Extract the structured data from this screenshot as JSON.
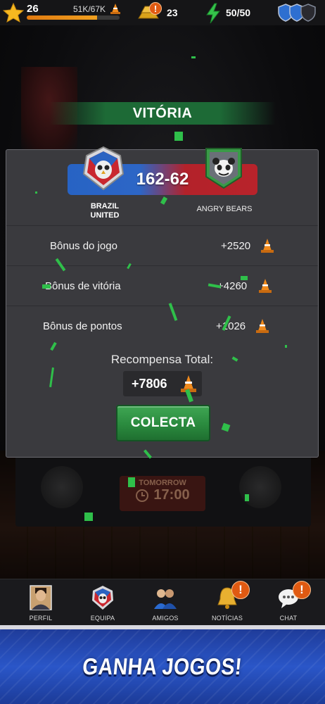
{
  "top_bar": {
    "level": "26",
    "xp_text": "51K/67K",
    "xp_progress": 0.76,
    "gold_count": "23",
    "energy_count": "50/50"
  },
  "result": {
    "banner": "VITÓRIA",
    "home_team": "BRAZIL UNITED",
    "away_team": "ANGRY BEARS",
    "score_home": "162",
    "score_sep": "-",
    "score_away": "62",
    "bonuses": [
      {
        "label": "Bônus do jogo",
        "value": "+2520"
      },
      {
        "label": "Bônus de vitória",
        "value": "+4260"
      },
      {
        "label": "Bônus de pontos",
        "value": "+1026"
      }
    ],
    "total_label": "Recompensa Total:",
    "total_value": "+7806",
    "collect_label": "COLECTA"
  },
  "background": {
    "tomorrow_label": "TOMORROW",
    "tomorrow_time": "17:00"
  },
  "nav": [
    {
      "label": "PERFIL",
      "icon": "profile-avatar-icon"
    },
    {
      "label": "EQUIPA",
      "icon": "team-emblem-icon"
    },
    {
      "label": "AMIGOS",
      "icon": "friends-icon"
    },
    {
      "label": "NOTÍCIAS",
      "icon": "news-bell-icon",
      "badge": "!"
    },
    {
      "label": "CHAT",
      "icon": "chat-bubble-icon",
      "badge": "!"
    }
  ],
  "promo": {
    "text": "GANHA JOGOS!"
  },
  "colors": {
    "victory_green": "#1d6a36",
    "collect_green": "#2a8a3e",
    "home_blue": "#2763c4",
    "away_red": "#b3222a",
    "cone_orange": "#f08a1c",
    "badge_orange": "#e05a12"
  }
}
